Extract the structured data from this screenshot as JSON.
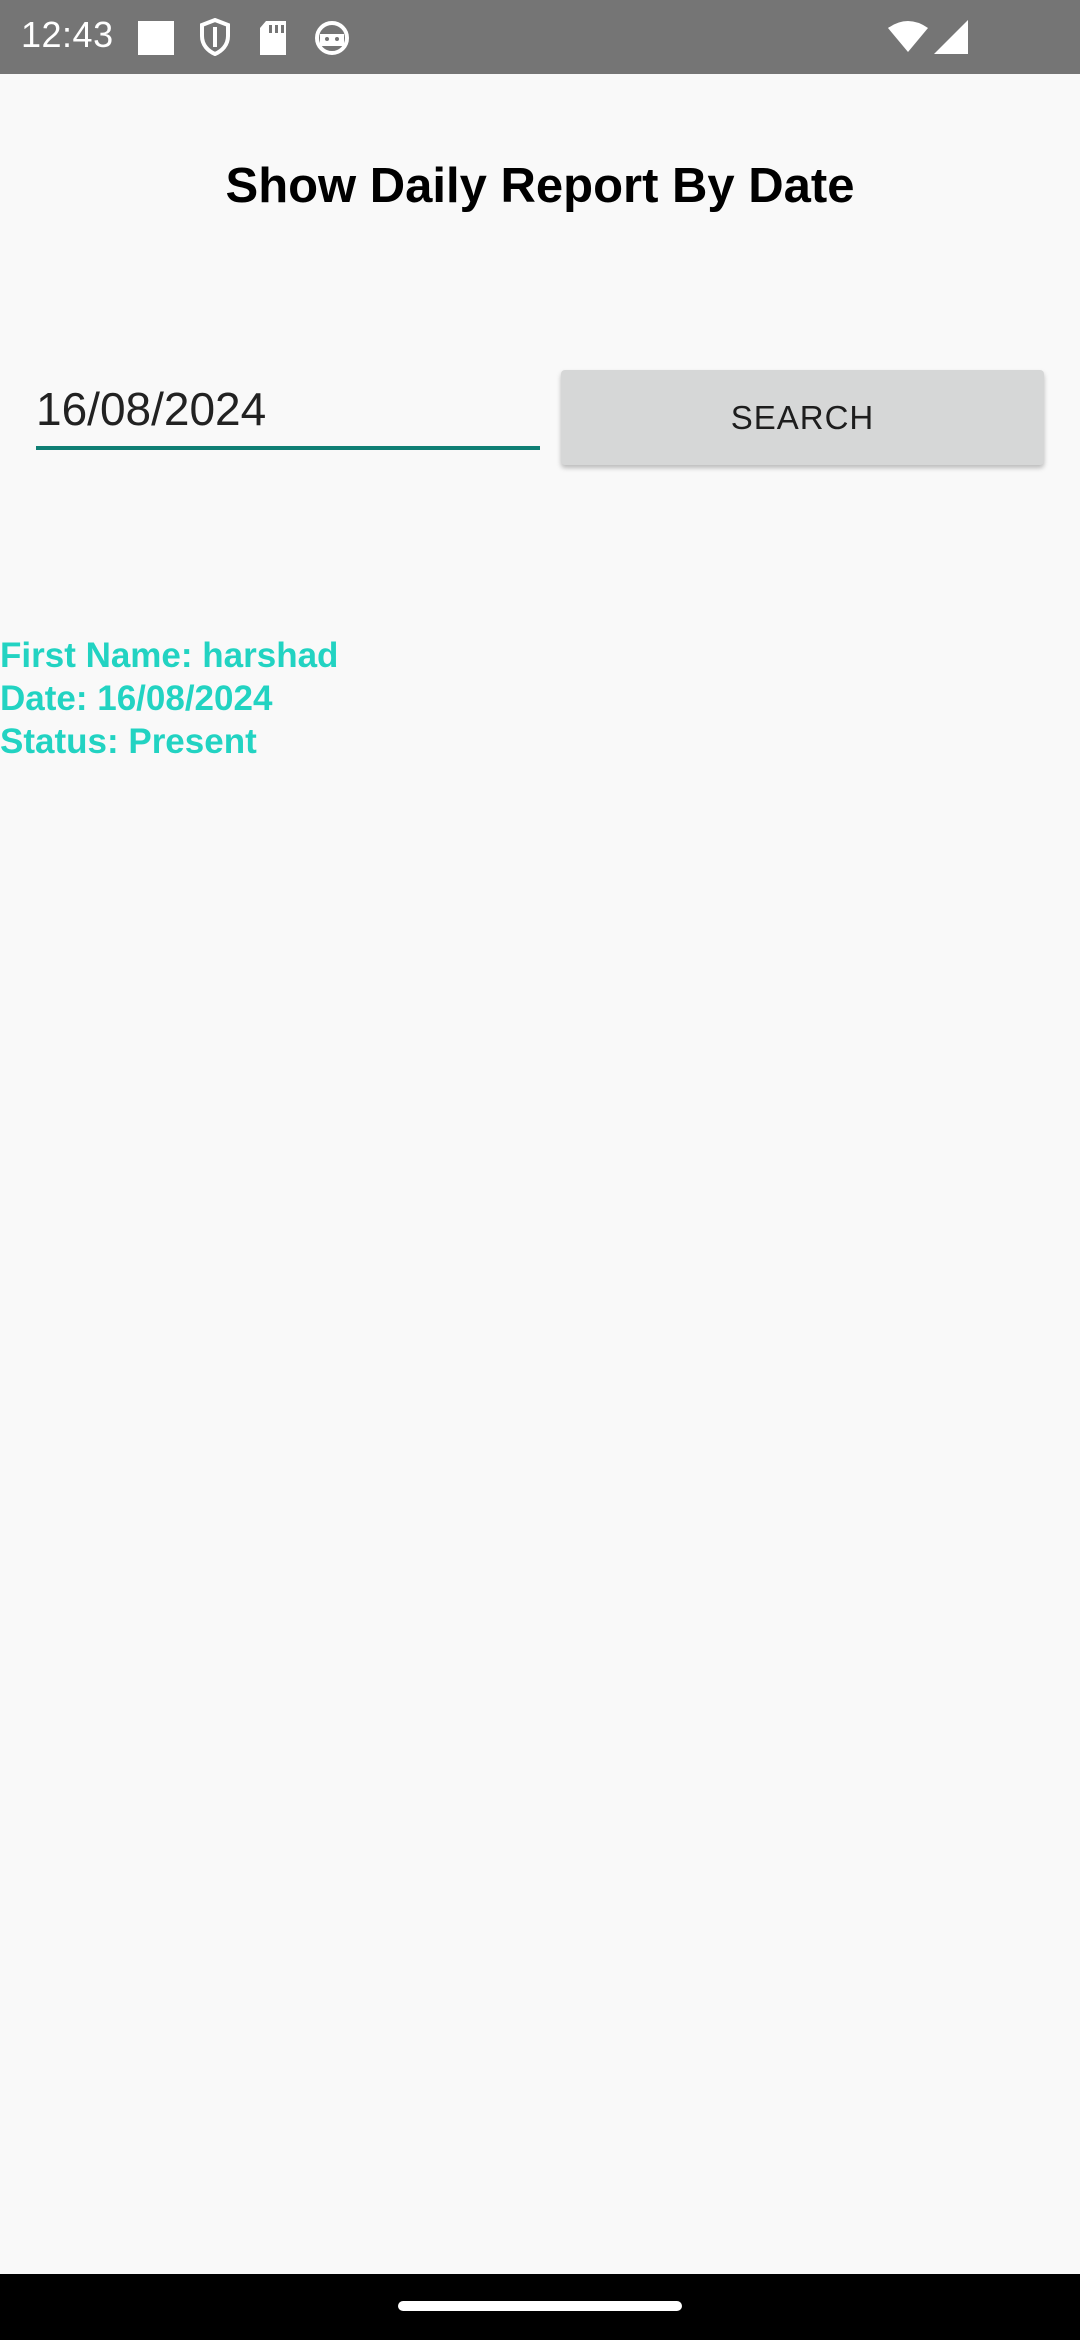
{
  "status_bar": {
    "time": "12:43",
    "icons": [
      "square-notification-icon",
      "shield-icon",
      "sd-card-icon",
      "android-icon"
    ],
    "right_icons": [
      "wifi-icon",
      "cellular-signal-icon"
    ]
  },
  "header": {
    "title": "Show Daily Report By Date"
  },
  "search": {
    "date_value": "16/08/2024",
    "button_label": "SEARCH"
  },
  "result": {
    "first_name_line": "First Name: harshad",
    "date_line": "Date: 16/08/2024",
    "status_line": "Status: Present"
  },
  "colors": {
    "accent": "#0f7f74",
    "result_text": "#22d3c2",
    "status_bar": "#757575",
    "button_bg": "#d6d7d7"
  }
}
